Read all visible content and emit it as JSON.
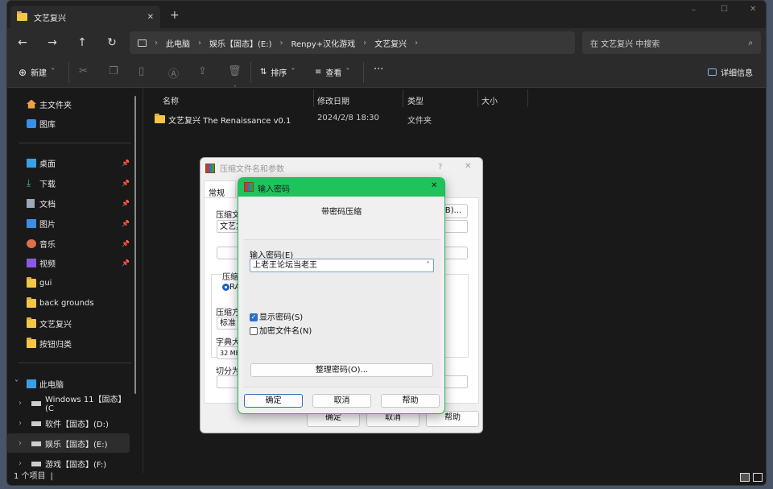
{
  "window": {
    "tab_title": "文艺复兴",
    "new_tab": "+",
    "controls": {
      "minimize": "–",
      "maximize": "☐",
      "close": "✕"
    }
  },
  "nav": {
    "back": "←",
    "forward": "→",
    "up": "↑",
    "refresh": "↻"
  },
  "breadcrumb": [
    "此电脑",
    "娱乐【固态】(E:)",
    "Renpy+汉化游戏",
    "文艺复兴"
  ],
  "search": {
    "placeholder": "在 文艺复兴 中搜索"
  },
  "toolbar": {
    "new": "新建",
    "sort": "排序",
    "view": "查看",
    "more": "···",
    "details": "详细信息"
  },
  "sidebar": {
    "quick": [
      {
        "label": "主文件夹",
        "icon": "home-icon"
      },
      {
        "label": "图库",
        "icon": "gallery-icon"
      }
    ],
    "pinned": [
      {
        "label": "桌面",
        "icon": "desktop-icon",
        "pinned": true
      },
      {
        "label": "下载",
        "icon": "download-icon",
        "pinned": true
      },
      {
        "label": "文档",
        "icon": "documents-icon",
        "pinned": true
      },
      {
        "label": "图片",
        "icon": "pictures-icon",
        "pinned": true
      },
      {
        "label": "音乐",
        "icon": "music-icon",
        "pinned": true
      },
      {
        "label": "视频",
        "icon": "videos-icon",
        "pinned": true
      },
      {
        "label": "gui",
        "icon": "folder-icon"
      },
      {
        "label": "back grounds",
        "icon": "folder-icon"
      },
      {
        "label": "文艺复兴",
        "icon": "folder-icon"
      },
      {
        "label": "按钮归类",
        "icon": "folder-icon"
      }
    ],
    "this_pc": "此电脑",
    "drives": [
      "Windows 11【固态】(C",
      "软件【固态】(D:)",
      "娱乐【固态】(E:)",
      "游戏【固态】(F:)"
    ],
    "selected_drive": "娱乐【固态】(E:)"
  },
  "columns": [
    "名称",
    "修改日期",
    "类型",
    "大小"
  ],
  "files": [
    {
      "name": "文艺复兴 The Renaissance v0.1",
      "modified": "2024/2/8 18:30",
      "type": "文件夹",
      "size": ""
    }
  ],
  "status": "1 个项目",
  "archive_dialog": {
    "title": "压缩文件名和参数",
    "help": "?",
    "close": "✕",
    "tab": "常规",
    "fragments": {
      "archive_name_label": "压缩文",
      "archive_name": "文艺复",
      "browse": "(B)...",
      "format_label": "压缩",
      "format_rar": "RA",
      "method_label": "压缩方",
      "method": "标准",
      "dict_label": "字典大",
      "dict": "32 MB",
      "split_label": "切分为"
    },
    "ok": "确定",
    "cancel": "取消",
    "help_btn": "帮助"
  },
  "password_dialog": {
    "title": "输入密码",
    "close": "✕",
    "heading": "带密码压缩",
    "password_label": "输入密码(E)",
    "password_value": "上老王论坛当老王",
    "show_password": {
      "label": "显示密码(S)",
      "checked": true
    },
    "encrypt_names": {
      "label": "加密文件名(N)",
      "checked": false
    },
    "organize": "整理密码(O)...",
    "ok": "确定",
    "cancel": "取消",
    "help": "帮助",
    "accent": "#1ec35c"
  }
}
